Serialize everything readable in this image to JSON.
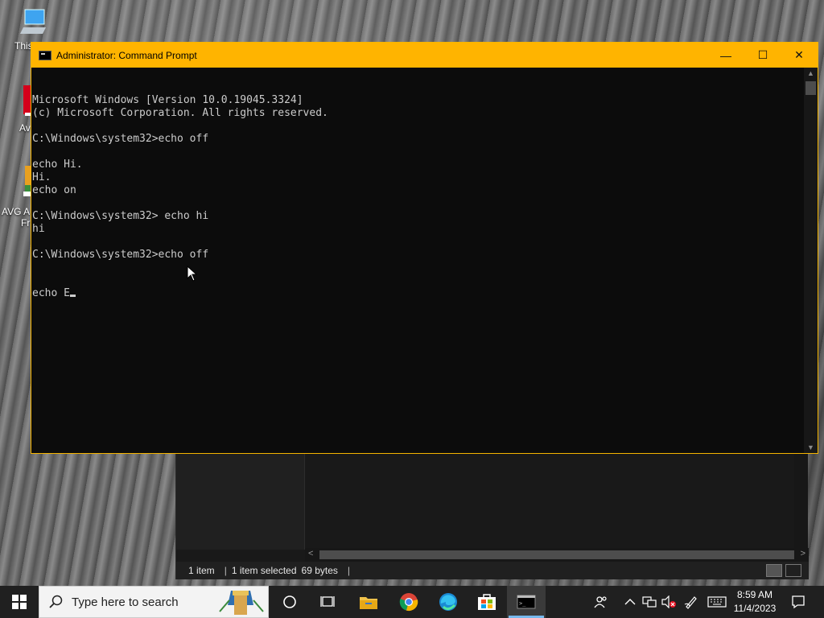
{
  "desktop": {
    "icons": [
      {
        "label": "This",
        "icon": "computer-icon"
      },
      {
        "label": "Av",
        "icon": "app-shortcut-icon"
      },
      {
        "label": "AVG A",
        "icon": "antivirus-shortcut-icon"
      }
    ],
    "icon_label_extra": "Fr"
  },
  "cmd": {
    "title": "Administrator: Command Prompt",
    "lines": [
      "Microsoft Windows [Version 10.0.19045.3324]",
      "(c) Microsoft Corporation. All rights reserved.",
      "",
      "C:\\Windows\\system32>echo off",
      "",
      "echo Hi.",
      "Hi.",
      "echo on",
      "",
      "C:\\Windows\\system32> echo hi",
      "hi",
      "",
      "C:\\Windows\\system32>echo off"
    ],
    "current_input": "echo E",
    "buttons": {
      "minimize": "—",
      "maximize": "☐",
      "close": "✕"
    },
    "accent_color": "#ffb400"
  },
  "explorer": {
    "status": {
      "items": "1 item",
      "selected": "1 item selected",
      "size": "69 bytes"
    }
  },
  "taskbar": {
    "search_placeholder": "Type here to search",
    "time": "8:59 AM",
    "date": "11/4/2023",
    "pinned": [
      "cortana-icon",
      "task-view-icon",
      "file-explorer-icon",
      "chrome-icon",
      "edge-icon",
      "store-icon",
      "cmd-icon"
    ]
  }
}
